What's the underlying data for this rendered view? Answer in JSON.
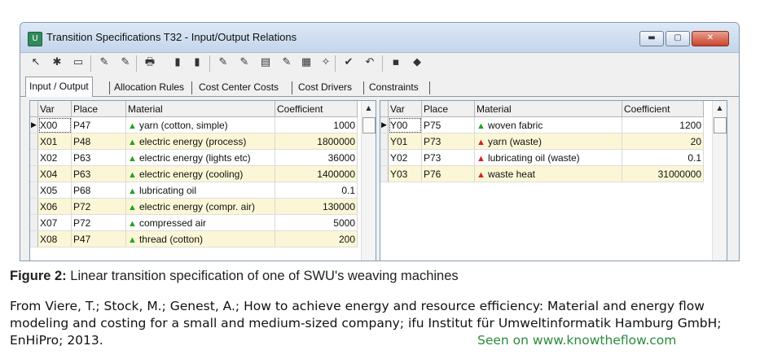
{
  "window": {
    "title": "Transition Specifications T32 - Input/Output Relations",
    "minimize_glyph": "▬",
    "maximize_glyph": "▢",
    "close_glyph": "✕"
  },
  "toolbar": {
    "icons": [
      "arrow-tool-icon",
      "star-new-icon",
      "copy-icon",
      "edit-icon",
      "edit2-icon",
      "print-icon",
      "bottles-icon",
      "bottles2-icon",
      "pen-icon",
      "pen2-icon",
      "chart-icon",
      "check-edit-icon",
      "grid-icon",
      "wand-icon",
      "check-icon",
      "undo-icon",
      "save-icon",
      "book-icon"
    ],
    "glyphs": [
      "↖",
      "✱",
      "▭",
      "✎",
      "✎",
      "🖶",
      "▮",
      "▮",
      "✎",
      "✎",
      "▤",
      "✎",
      "▦",
      "✧",
      "✔",
      "↶",
      "▪",
      "◆"
    ]
  },
  "tabs": [
    "Input / Output",
    "Allocation Rules",
    "Cost Center Costs",
    "Cost Drivers",
    "Constraints"
  ],
  "left_grid": {
    "headers": [
      "Var",
      "Place",
      "Material",
      "Coefficient"
    ],
    "rows": [
      {
        "var": "X00",
        "place": "P47",
        "material": "yarn (cotton, simple)",
        "coef": "1000",
        "tri": "g"
      },
      {
        "var": "X01",
        "place": "P48",
        "material": "electric energy (process)",
        "coef": "1800000",
        "tri": "g"
      },
      {
        "var": "X02",
        "place": "P63",
        "material": "electric energy (lights etc)",
        "coef": "36000",
        "tri": "g"
      },
      {
        "var": "X04",
        "place": "P63",
        "material": "electric energy (cooling)",
        "coef": "1400000",
        "tri": "g"
      },
      {
        "var": "X05",
        "place": "P68",
        "material": "lubricating oil",
        "coef": "0.1",
        "tri": "g"
      },
      {
        "var": "X06",
        "place": "P72",
        "material": "electric energy  (compr. air)",
        "coef": "130000",
        "tri": "g"
      },
      {
        "var": "X07",
        "place": "P72",
        "material": "compressed air",
        "coef": "5000",
        "tri": "g"
      },
      {
        "var": "X08",
        "place": "P47",
        "material": "thread (cotton)",
        "coef": "200",
        "tri": "g"
      }
    ]
  },
  "right_grid": {
    "headers": [
      "Var",
      "Place",
      "Material",
      "Coefficient"
    ],
    "rows": [
      {
        "var": "Y00",
        "place": "P75",
        "material": "woven fabric",
        "coef": "1200",
        "tri": "g"
      },
      {
        "var": "Y01",
        "place": "P73",
        "material": "yarn (waste)",
        "coef": "20",
        "tri": "r"
      },
      {
        "var": "Y02",
        "place": "P73",
        "material": "lubricating oil (waste)",
        "coef": "0.1",
        "tri": "r"
      },
      {
        "var": "Y03",
        "place": "P76",
        "material": "waste heat",
        "coef": "31000000",
        "tri": "r"
      }
    ]
  },
  "caption": {
    "label": "Figure 2:",
    "text": " Linear transition specification of one of SWU's weaving machines"
  },
  "source": "From Viere, T.; Stock, M.; Genest, A.; How to achieve energy and resource efficiency: Material and energy flow modeling and costing for a small and medium-sized company; ifu Institut für Umweltinformatik Hamburg GmbH; EnHiPro; 2013.",
  "seen_on": "Seen on www.knowtheflow.com",
  "colors": {
    "green_triangle": "#22a322",
    "red_triangle": "#d62020",
    "alt_row": "#fbf7d6",
    "seen_on": "#2b8a3e"
  }
}
